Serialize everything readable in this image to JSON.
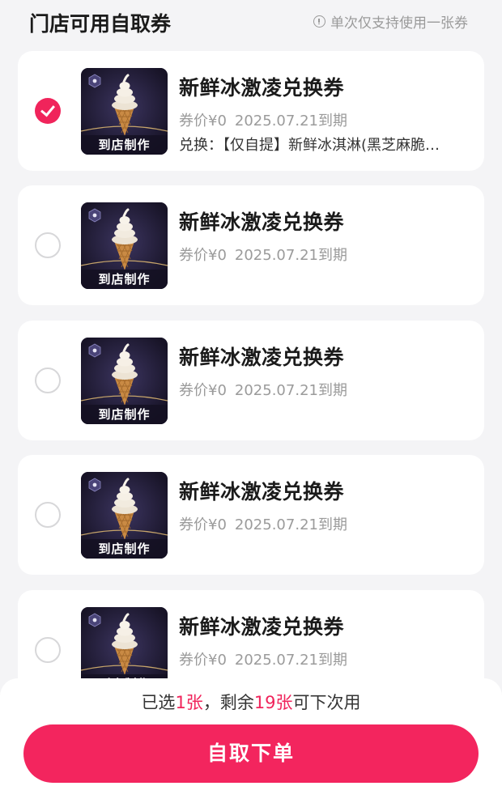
{
  "header": {
    "title": "门店可用自取券",
    "note": "单次仅支持使用一张券",
    "note_icon": "info-icon"
  },
  "coupons": [
    {
      "title": "新鲜冰激凌兑换券",
      "price": "券价¥0",
      "expiry": "2025.07.21到期",
      "description": "兑换：【仅自提】新鲜冰淇淋(黑芝麻脆…",
      "badge": "到店制作",
      "selected": true
    },
    {
      "title": "新鲜冰激凌兑换券",
      "price": "券价¥0",
      "expiry": "2025.07.21到期",
      "description": "",
      "badge": "到店制作",
      "selected": false
    },
    {
      "title": "新鲜冰激凌兑换券",
      "price": "券价¥0",
      "expiry": "2025.07.21到期",
      "description": "",
      "badge": "到店制作",
      "selected": false
    },
    {
      "title": "新鲜冰激凌兑换券",
      "price": "券价¥0",
      "expiry": "2025.07.21到期",
      "description": "",
      "badge": "到店制作",
      "selected": false
    },
    {
      "title": "新鲜冰激凌兑换券",
      "price": "券价¥0",
      "expiry": "2025.07.21到期",
      "description": "",
      "badge": "到店制作",
      "selected": false
    }
  ],
  "footer": {
    "summary_prefix": "已选",
    "selected_count": "1张",
    "summary_middle": "，剩余",
    "remaining_count": "19张",
    "summary_suffix": "可下次用",
    "submit_label": "自取下单"
  },
  "colors": {
    "accent": "#f0245b",
    "background": "#f4f4f6"
  }
}
